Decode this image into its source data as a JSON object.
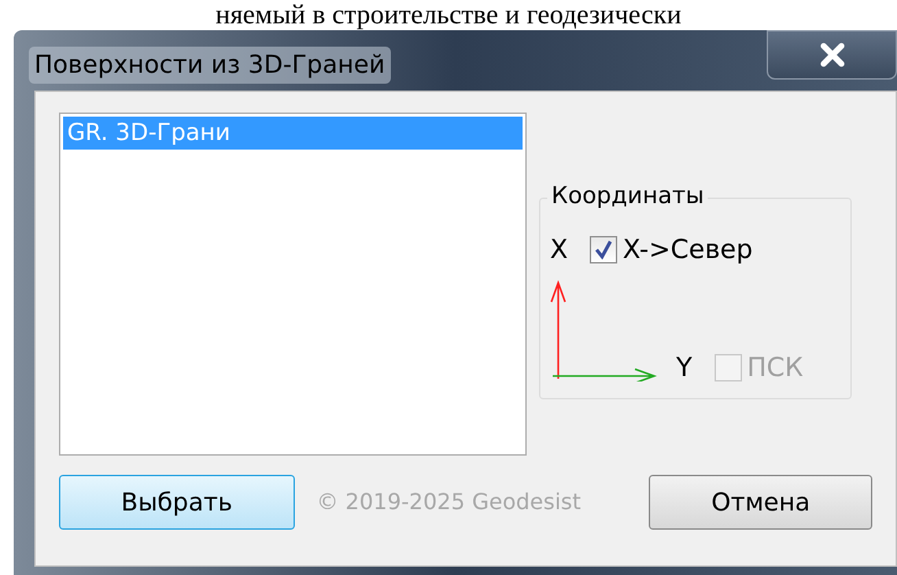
{
  "background_text": "няемый в строительстве и геодезически",
  "window": {
    "title": "Поверхности из 3D-Граней"
  },
  "list": {
    "items": [
      {
        "label": "GR. 3D-Грани",
        "selected": true
      }
    ]
  },
  "coordinates": {
    "title": "Координаты",
    "x_label": "X",
    "y_label": "Y",
    "checkboxes": [
      {
        "label": "X->Север",
        "checked": true,
        "disabled": false
      },
      {
        "label": "ПСК",
        "checked": false,
        "disabled": true
      }
    ]
  },
  "buttons": [
    {
      "label": "Выбрать",
      "default": true
    },
    {
      "label": "Отмена",
      "default": false
    }
  ],
  "copyright": "© 2019-2025 Geodesist"
}
